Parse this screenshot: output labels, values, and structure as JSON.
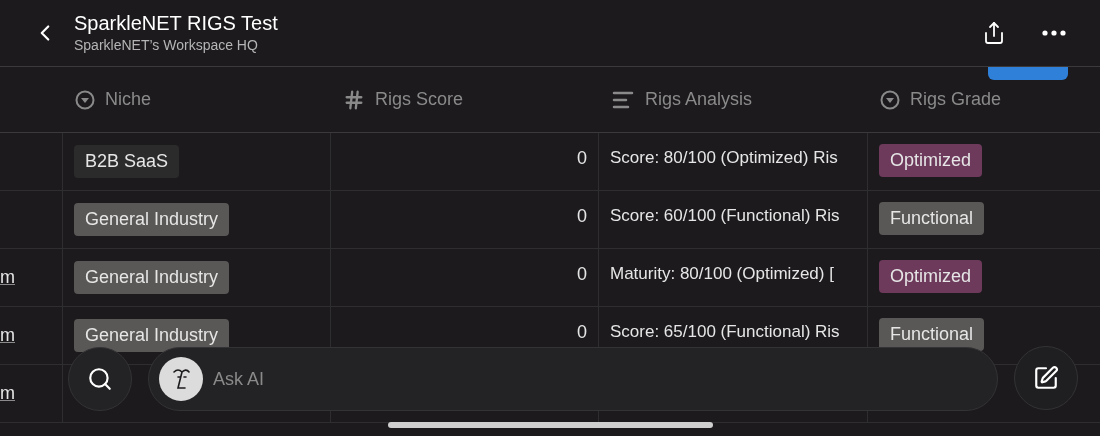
{
  "header": {
    "title": "SparkleNET RIGS Test",
    "subtitle": "SparkleNET’s Workspace HQ"
  },
  "columns": [
    {
      "kind": "select",
      "label": "Niche"
    },
    {
      "kind": "number",
      "label": "Rigs Score"
    },
    {
      "kind": "text",
      "label": "Rigs Analysis"
    },
    {
      "kind": "select",
      "label": "Rigs Grade"
    }
  ],
  "rows": [
    {
      "column_1": "",
      "niche": {
        "label": "B2B SaaS",
        "color": "#2c2b2b"
      },
      "score": "0",
      "analysis": "Score: 80/100 (Optimized) Ris",
      "grade": {
        "label": "Optimized",
        "color": "#6e3a5c"
      }
    },
    {
      "column_1": "",
      "niche": {
        "label": "General Industry",
        "color": "#5a5856"
      },
      "score": "0",
      "analysis": "Score: 60/100 (Functional) Ris",
      "grade": {
        "label": "Functional",
        "color": "#5a5856"
      }
    },
    {
      "column_1": "m",
      "niche": {
        "label": "General Industry",
        "color": "#5a5856"
      },
      "score": "0",
      "analysis": "Maturity: 80/100 (Optimized) [",
      "grade": {
        "label": "Optimized",
        "color": "#6e3a5c"
      }
    },
    {
      "column_1": "m",
      "niche": {
        "label": "General Industry",
        "color": "#5a5856"
      },
      "score": "0",
      "analysis": "Score: 65/100 (Functional) Ris",
      "grade": {
        "label": "Functional",
        "color": "#5a5856"
      }
    },
    {
      "column_1": "m"
    }
  ],
  "ask_bar": {
    "placeholder": "Ask AI"
  }
}
